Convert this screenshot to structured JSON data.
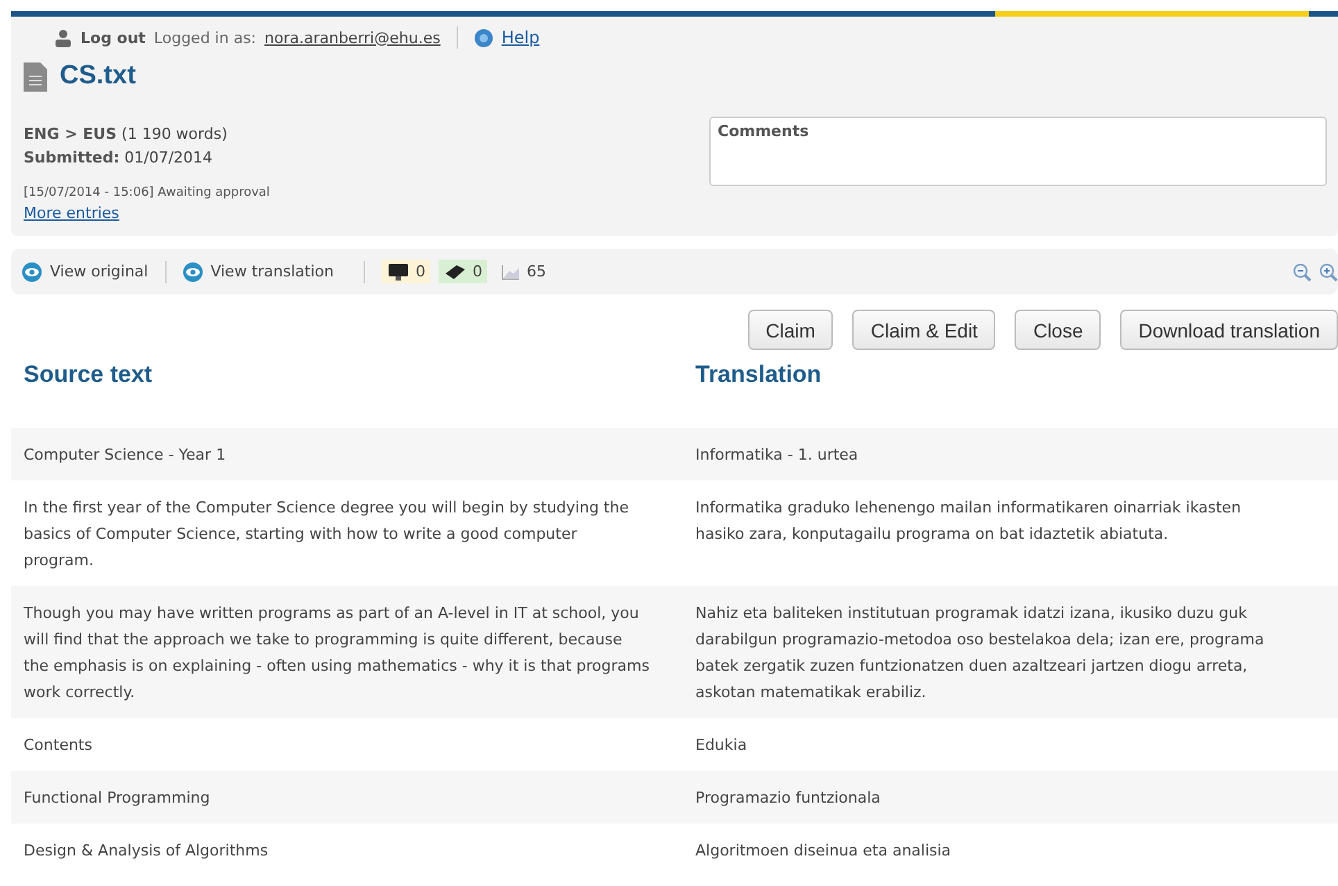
{
  "user_bar": {
    "logout": "Log out",
    "logged_in_label": "Logged in as:",
    "email": "nora.aranberri@ehu.es",
    "help": "Help"
  },
  "document": {
    "title": "CS.txt",
    "source_lang": "ENG",
    "target_lang": "EUS",
    "separator": ">",
    "word_count": "(1 190 words)",
    "submitted_label": "Submitted:",
    "submitted_date": "01/07/2014",
    "history_entry": "[15/07/2014 - 15:06] Awaiting approval",
    "more_entries": "More entries"
  },
  "comments": {
    "placeholder": "Comments"
  },
  "toolbar": {
    "view_original": "View original",
    "view_translation": "View translation",
    "counters": [
      {
        "kind": "machine",
        "value": "0",
        "color": "#fdf3d6"
      },
      {
        "kind": "memory",
        "value": "0",
        "color": "#d9efd3"
      },
      {
        "kind": "chart",
        "value": "65"
      }
    ]
  },
  "actions": [
    "Claim",
    "Claim & Edit",
    "Close",
    "Download translation"
  ],
  "table": {
    "columns": [
      "Source text",
      "Translation"
    ],
    "rows": [
      {
        "source": "Computer Science - Year 1",
        "translation": "Informatika - 1. urtea"
      },
      {
        "source": "In the first year of the Computer Science degree you will begin by studying the basics of Computer Science, starting with how to write a good computer program.",
        "translation": "Informatika graduko lehenengo mailan informatikaren oinarriak ikasten hasiko zara, konputagailu programa on bat idaztetik abiatuta."
      },
      {
        "source": "Though you may have written programs as part of an A-level in IT at school, you will find that the approach we take to programming is quite different, because the emphasis is on explaining - often using mathematics - why it is that programs work correctly.",
        "translation": "Nahiz eta baliteken institutuan programak idatzi izana, ikusiko duzu guk darabilgun programazio-metodoa oso bestelakoa dela; izan ere, programa batek zergatik zuzen funtzionatzen duen azaltzeari jartzen diogu arreta, askotan matematikak erabiliz."
      },
      {
        "source": "Contents",
        "translation": "Edukia"
      },
      {
        "source": "Functional Programming",
        "translation": "Programazio funtzionala"
      },
      {
        "source": "Design & Analysis of Algorithms",
        "translation": "Algoritmoen diseinua eta analisia"
      }
    ]
  }
}
